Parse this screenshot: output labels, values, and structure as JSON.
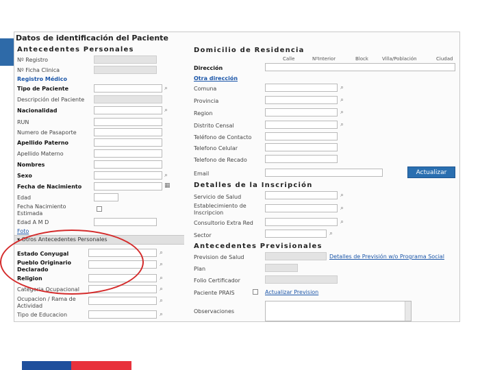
{
  "panel_title": "Datos de identificación del Paciente",
  "left": {
    "section_title": "Antecedentes Personales",
    "registro_medico_link": "Registro Médico",
    "fields": {
      "n_registro": "Nº Registro",
      "n_ficha": "Nº Ficha Clinica",
      "tipo_paciente": "Tipo de Paciente",
      "descripcion": "Descripción del Paciente",
      "nacionalidad": "Nacionalidad",
      "run": "RUN",
      "pasaporte": "Numero de Pasaporte",
      "apellido_paterno": "Apellido Paterno",
      "apellido_materno": "Apellido Materno",
      "nombres": "Nombres",
      "sexo": "Sexo",
      "fecha_nacimiento": "Fecha de Nacimiento",
      "edad": "Edad",
      "fecha_nac_estimada": "Fecha Nacimiento Estimada",
      "edad_amd": "Edad A M D"
    },
    "foto_link": "Foto",
    "otros_header": "▾ Otros Antecedentes Personales",
    "otros": {
      "estado_conyugal": "Estado Conyugal",
      "pueblo_originario": "Pueblo Originario Declarado",
      "religion": "Religion",
      "categoria_ocupacional": "Categoria Ocupacional",
      "ocupacion": "Ocupacion / Rama de Actividad",
      "tipo_educacion": "Tipo de Educacion"
    }
  },
  "right": {
    "domicilio_title": "Domicilio de Residencia",
    "col_headers": [
      "Calle",
      "NºInterior",
      "Block",
      "Villa/Población",
      "Ciudad"
    ],
    "direccion": "Dirección",
    "otra_direccion_link": "Otra dirección",
    "comuna": "Comuna",
    "provincia": "Provincia",
    "region": "Region",
    "distrito_censal": "Distrito Censal",
    "telefono_contacto": "Teléfono de Contacto",
    "telefono_celular": "Telefono Celular",
    "telefono_recado": "Telefono de Recado",
    "email": "Email",
    "actualizar_button": "Actualizar",
    "inscripcion_title": "Detalles de la Inscripción",
    "servicio_salud": "Servicio de Salud",
    "establecimiento": "Establecimiento de Inscripcion",
    "consultorio": "Consultorio Extra Red",
    "sector": "Sector",
    "previsionales_title": "Antecedentes Previsionales",
    "prevision_salud": "Prevision de Salud",
    "detalles_prevision_link": "Detalles de Previsión w/o Programa Social",
    "plan": "Plan",
    "folio": "Folio Certificador",
    "paciente_prais": "Paciente PRAIS",
    "actualizar_prevision_link": "Actualizar Prevision",
    "observaciones": "Observaciones"
  },
  "colors": {
    "accent_blue": "#2e6aa8",
    "highlight_red": "#d42b2b",
    "footer_blue": "#1f4f9c",
    "footer_red": "#e8323c"
  }
}
